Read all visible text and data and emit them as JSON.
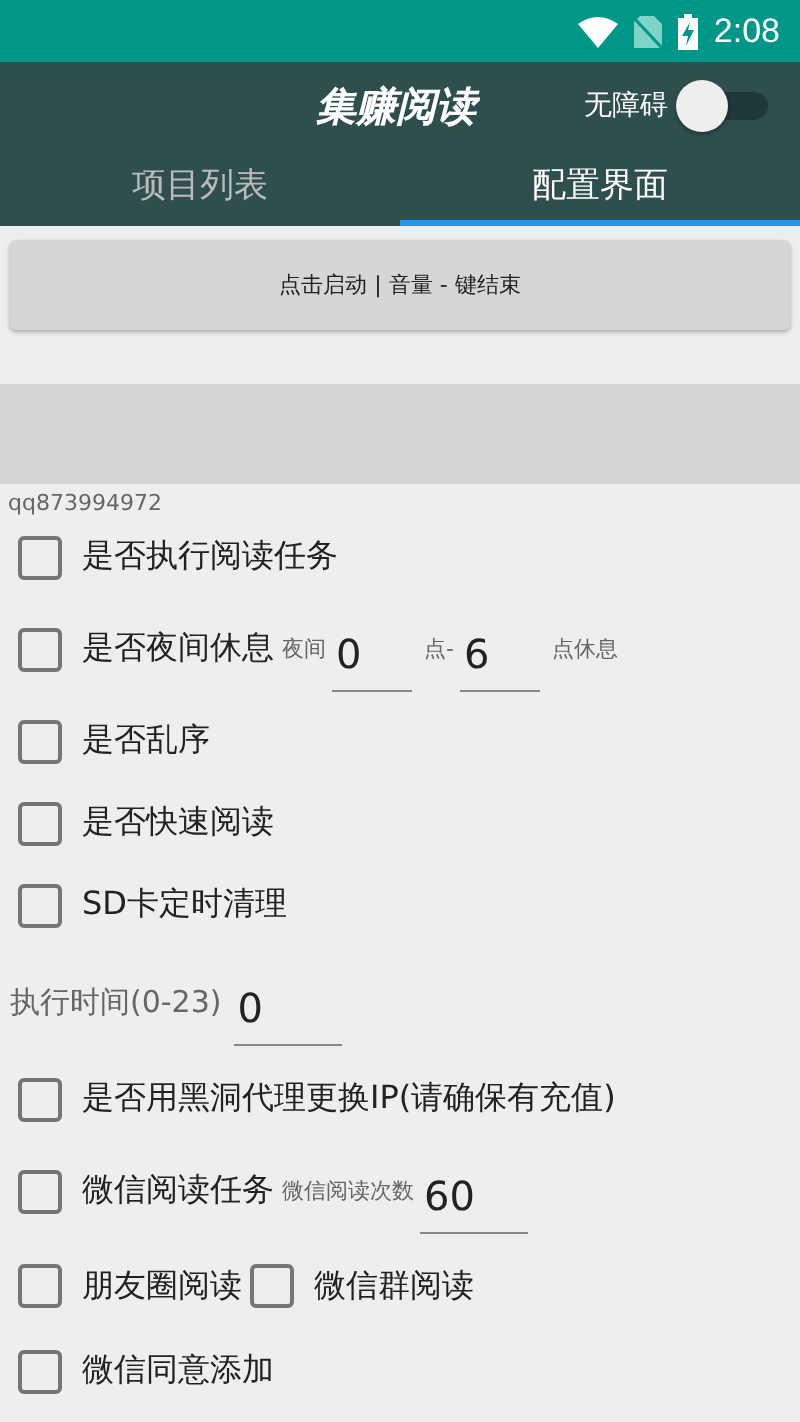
{
  "status_bar": {
    "time": "2:08"
  },
  "app_bar": {
    "title": "集赚阅读",
    "switch": {
      "label": "无障碍",
      "on": false
    }
  },
  "tabs": [
    {
      "label": "项目列表",
      "selected": false
    },
    {
      "label": "配置界面",
      "selected": true
    }
  ],
  "start_button": "点击启动 | 音量 - 键结束",
  "account": "qq873994972",
  "settings": [
    {
      "kind": "check",
      "label": "是否执行阅读任务",
      "checked": false
    },
    {
      "kind": "check",
      "label": "是否夜间休息",
      "checked": false,
      "extras": [
        {
          "kind": "note",
          "text": "夜间"
        },
        {
          "kind": "field",
          "value": "0"
        },
        {
          "kind": "note",
          "text": "点-"
        },
        {
          "kind": "field",
          "value": "6"
        },
        {
          "kind": "note",
          "text": "点休息"
        }
      ]
    },
    {
      "kind": "check",
      "label": "是否乱序",
      "checked": false
    },
    {
      "kind": "check",
      "label": "是否快速阅读",
      "checked": false
    },
    {
      "kind": "check",
      "label": "SD卡定时清理",
      "checked": false
    },
    {
      "kind": "field",
      "label": "执行时间(0-23)",
      "value": "0"
    },
    {
      "kind": "check",
      "label": "是否用黑洞代理更换IP(请确保有充值)",
      "checked": false
    },
    {
      "kind": "check",
      "label": "微信阅读任务",
      "checked": false,
      "extras": [
        {
          "kind": "note",
          "text": "微信阅读次数"
        },
        {
          "kind": "field",
          "value": "60"
        }
      ]
    },
    {
      "kind": "pair",
      "items": [
        {
          "label": "朋友圈阅读",
          "checked": false
        },
        {
          "label": "微信群阅读",
          "checked": false
        }
      ]
    },
    {
      "kind": "check",
      "label": "微信同意添加",
      "checked": false
    }
  ]
}
